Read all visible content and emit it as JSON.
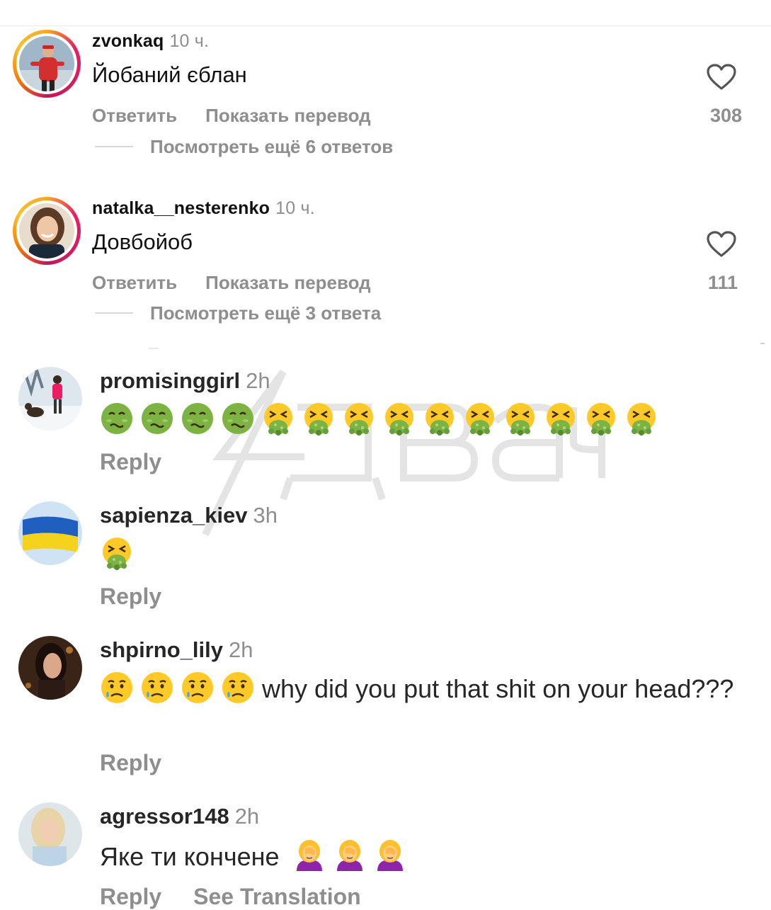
{
  "comments_ru": [
    {
      "username": "zvonkaq",
      "time": "10 ч.",
      "text": "Йобаний єблан",
      "reply_label": "Ответить",
      "translate_label": "Показать перевод",
      "likes": "308",
      "view_more": "Посмотреть ещё 6 ответов",
      "avatar_icon": "avatar-photo-man-red-jacket"
    },
    {
      "username": "natalka__nesterenko",
      "time": "10 ч.",
      "text": "Довбойоб",
      "reply_label": "Ответить",
      "translate_label": "Показать перевод",
      "likes": "111",
      "view_more": "Посмотреть ещё 3 ответа",
      "avatar_icon": "avatar-photo-woman-smiling"
    }
  ],
  "comments_en": [
    {
      "username": "promisinggirl",
      "time": "2h",
      "emojis": [
        "nauseated",
        "nauseated",
        "nauseated",
        "nauseated",
        "vomiting",
        "vomiting",
        "vomiting",
        "vomiting",
        "vomiting",
        "vomiting",
        "vomiting",
        "vomiting",
        "vomiting",
        "vomiting"
      ],
      "reply_label": "Reply",
      "avatar_icon": "avatar-photo-snow-dog"
    },
    {
      "username": "sapienza_kiev",
      "time": "3h",
      "emojis": [
        "vomiting"
      ],
      "reply_label": "Reply",
      "avatar_icon": "avatar-ukraine-flag"
    },
    {
      "username": "shpirno_lily",
      "time": "2h",
      "emojis": [
        "crying",
        "crying",
        "crying",
        "crying"
      ],
      "text": "why did you put that shit on your head???",
      "reply_label": "Reply",
      "avatar_icon": "avatar-photo-dark-hair-woman"
    },
    {
      "username": "agressor148",
      "time": "2h",
      "text": "Яке ти кончене",
      "emojis": [
        "facepalm",
        "facepalm",
        "facepalm"
      ],
      "reply_label": "Reply",
      "translate_label": "See Translation",
      "avatar_icon": "avatar-photo-blonde-woman"
    }
  ],
  "watermark": "2ch-watermark",
  "colors": {
    "muted": "#8e8e8e",
    "text": "#111111",
    "story_ring_start": "#f9a825",
    "story_ring_end": "#d81b60"
  }
}
